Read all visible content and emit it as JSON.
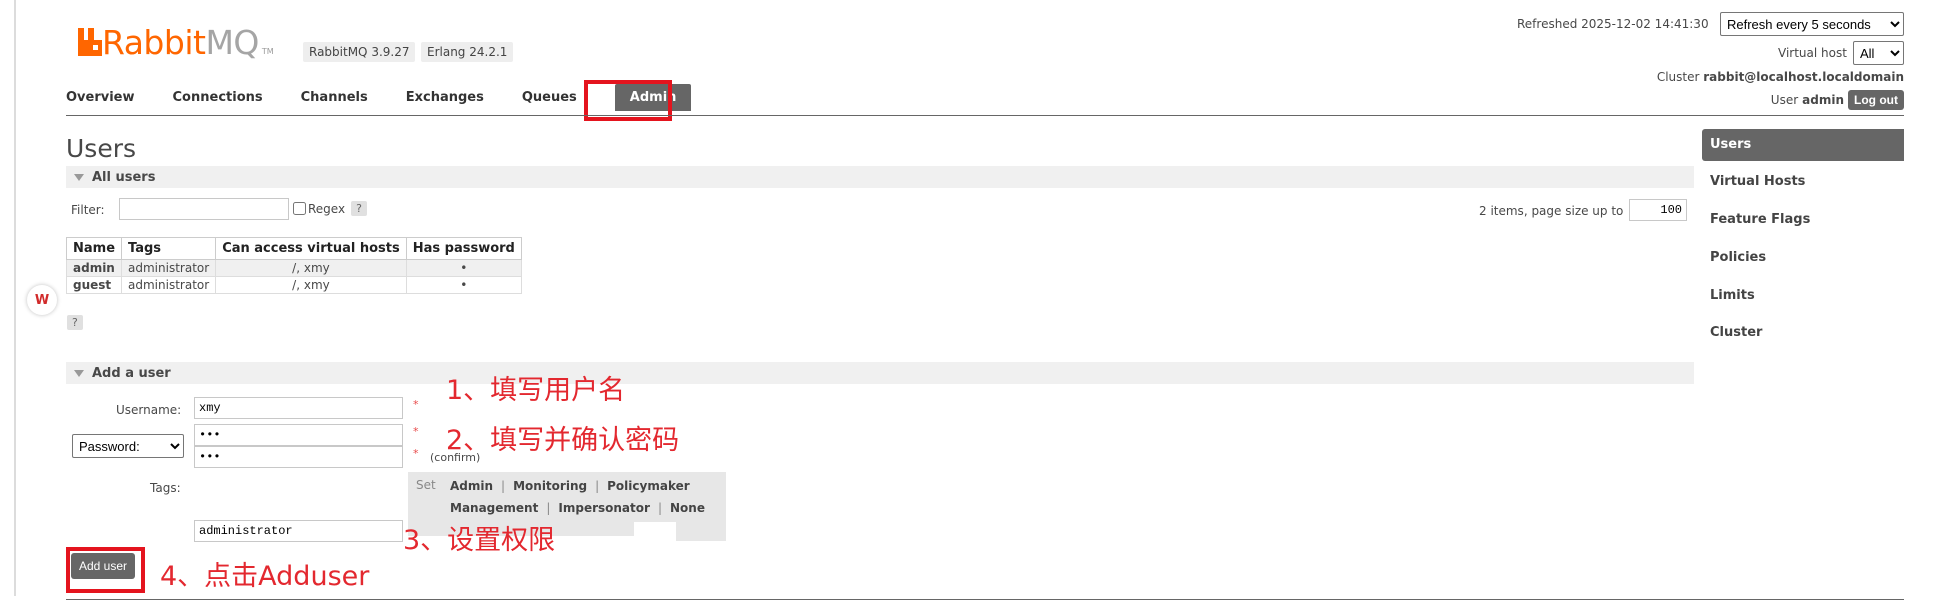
{
  "header": {
    "logo": {
      "word_orange": "Rabbit",
      "word_gray": "MQ",
      "tm": "TM"
    },
    "rabbitmq_version": "RabbitMQ 3.9.27",
    "erlang_version": "Erlang 24.2.1",
    "refreshed_label": "Refreshed 2025-12-02 14:41:30",
    "refresh_option": "Refresh every 5 seconds",
    "virtual_host_label": "Virtual host",
    "virtual_host_value": "All",
    "cluster_label": "Cluster",
    "cluster_value": "rabbit@localhost.localdomain",
    "user_label": "User",
    "user_value": "admin",
    "logout_label": "Log out"
  },
  "tabs": [
    {
      "label": "Overview"
    },
    {
      "label": "Connections"
    },
    {
      "label": "Channels"
    },
    {
      "label": "Exchanges"
    },
    {
      "label": "Queues"
    },
    {
      "label": "Admin",
      "active": true
    }
  ],
  "sidebar": {
    "items": [
      {
        "label": "Users",
        "active": true
      },
      {
        "label": "Virtual Hosts"
      },
      {
        "label": "Feature Flags"
      },
      {
        "label": "Policies"
      },
      {
        "label": "Limits"
      },
      {
        "label": "Cluster"
      }
    ]
  },
  "page": {
    "title": "Users",
    "all_users_label": "All users",
    "filter_label": "Filter:",
    "filter_value": "",
    "regex_label": "Regex",
    "help": "?",
    "pagination_label": "2 items, page size up to",
    "page_size": "100",
    "table": {
      "headers": [
        "Name",
        "Tags",
        "Can access virtual hosts",
        "Has password"
      ],
      "rows": [
        {
          "name": "admin",
          "tags": "administrator",
          "vhosts": "/, xmy",
          "has_password": "•"
        },
        {
          "name": "guest",
          "tags": "administrator",
          "vhosts": "/, xmy",
          "has_password": "•"
        }
      ]
    }
  },
  "add_user": {
    "section_label": "Add a user",
    "username_label": "Username:",
    "username_value": "xmy",
    "password_mode": "Password:",
    "password_value": "•••",
    "confirm_value": "•••",
    "confirm_hint": "(confirm)",
    "required_mark": "*",
    "tags_label": "Tags:",
    "set_label": "Set",
    "tag_options": [
      "Admin",
      "Monitoring",
      "Policymaker",
      "Management",
      "Impersonator",
      "None"
    ],
    "tag_separator": "|",
    "tags_value": "administrator",
    "add_button": "Add user"
  },
  "annotations": {
    "step1": "1、填写用户名",
    "step2": "2、填写并确认密码",
    "step3": "3、设置权限",
    "step4": "4、点击Adduser",
    "color": "#e3282f"
  },
  "colors": {
    "brand_orange": "#ff6600",
    "active_tab": "#666666",
    "annotation_red": "#e4141e"
  },
  "widgets": {
    "wps_icon": "wps-logo-icon"
  }
}
